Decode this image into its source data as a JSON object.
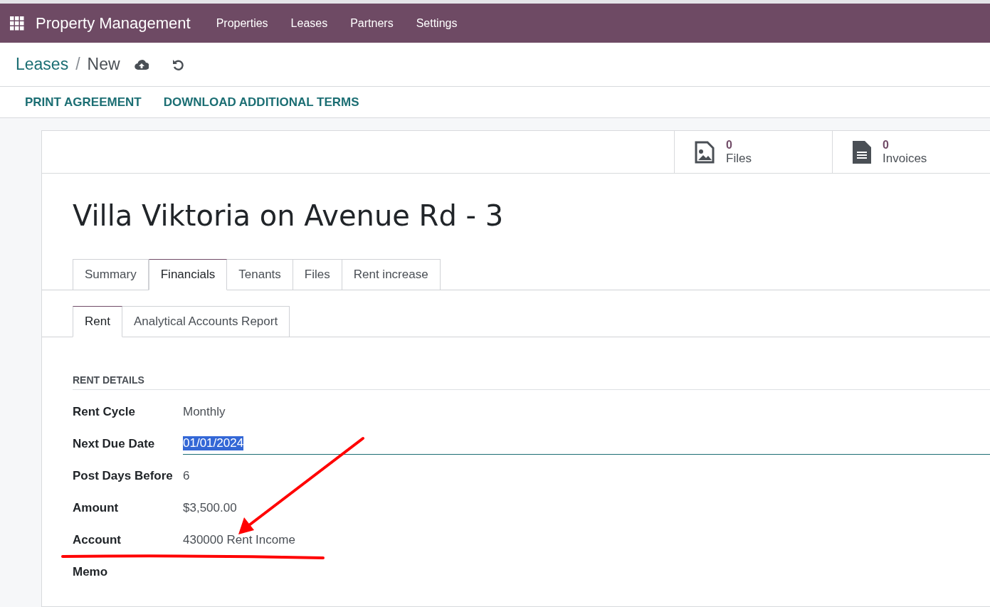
{
  "navbar": {
    "app_name": "Property Management",
    "menu": [
      "Properties",
      "Leases",
      "Partners",
      "Settings"
    ]
  },
  "breadcrumb": {
    "parent": "Leases",
    "separator": "/",
    "current": "New"
  },
  "actions": [
    "PRINT AGREEMENT",
    "DOWNLOAD ADDITIONAL TERMS"
  ],
  "stat_buttons": [
    {
      "kind": "image",
      "count": "0",
      "label": "Files"
    },
    {
      "kind": "document",
      "count": "0",
      "label": "Invoices"
    }
  ],
  "title": "Villa Viktoria on Avenue Rd - 3",
  "tabs": [
    {
      "label": "Summary",
      "selected": false
    },
    {
      "label": "Financials",
      "selected": true
    },
    {
      "label": "Tenants",
      "selected": false
    },
    {
      "label": "Files",
      "selected": false
    },
    {
      "label": "Rent increase",
      "selected": false
    }
  ],
  "subtabs": [
    {
      "label": "Rent",
      "selected": true
    },
    {
      "label": "Analytical Accounts Report",
      "selected": false
    }
  ],
  "section_title": "RENT DETAILS",
  "fields": [
    {
      "label": "Rent Cycle",
      "value": "Monthly",
      "focused": false
    },
    {
      "label": "Next Due Date",
      "value": "01/01/2024",
      "focused": true
    },
    {
      "label": "Post Days Before",
      "value": "6",
      "focused": false
    },
    {
      "label": "Amount",
      "value": "$3,500.00",
      "focused": false
    },
    {
      "label": "Account",
      "value": "430000 Rent Income",
      "focused": false
    },
    {
      "label": "Memo",
      "focused": false
    }
  ]
}
